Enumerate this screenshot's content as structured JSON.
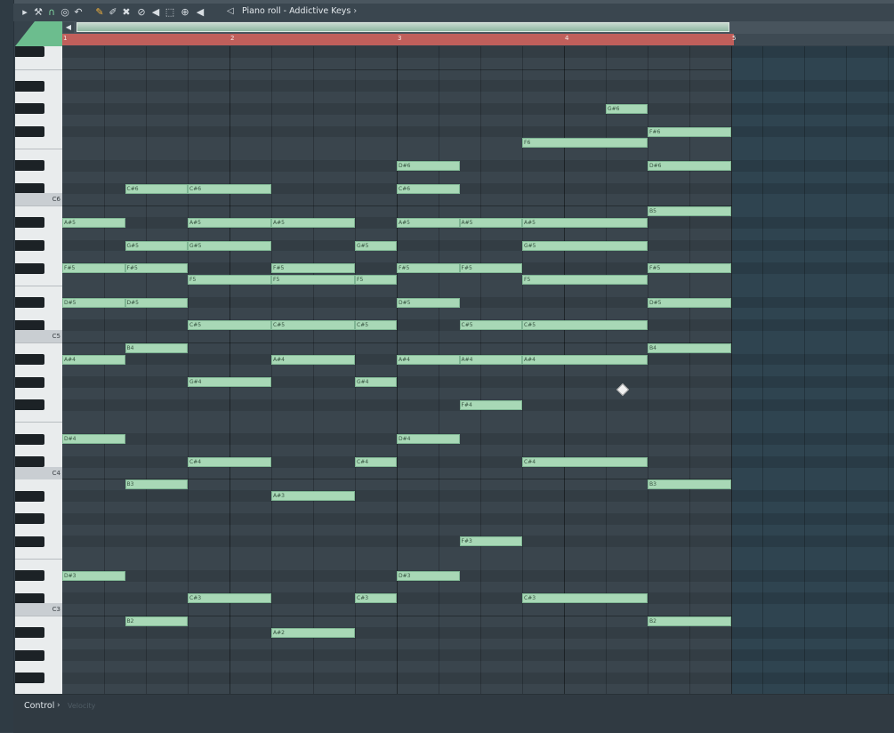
{
  "window": {
    "title": "Piano roll - Addictive Keys"
  },
  "toolbar": {
    "icons": [
      "arrow-right-icon",
      "wrench-icon",
      "magnet-icon",
      "record-icon",
      "undo-icon",
      "pencil-icon",
      "paint-brush-icon",
      "delete-icon",
      "mute-icon",
      "slip-icon",
      "select-icon",
      "zoom-icon",
      "playback-icon",
      "speaker-icon"
    ]
  },
  "timeline": {
    "bars": [
      "1",
      "2",
      "3",
      "4",
      "5"
    ]
  },
  "keyboard": {
    "c_labels": [
      "C6",
      "C5",
      "C4",
      "C3"
    ]
  },
  "control": {
    "label": "Control",
    "sub_label": "Velocity"
  },
  "notes": [
    {
      "label": "G#6"
    },
    {
      "label": "F#6"
    },
    {
      "label": "F6"
    },
    {
      "label": "D#6"
    },
    {
      "label": "D#6"
    },
    {
      "label": "C#6"
    },
    {
      "label": "C#6"
    },
    {
      "label": "C#6"
    },
    {
      "label": "B5"
    },
    {
      "label": "A#5"
    },
    {
      "label": "A#5"
    },
    {
      "label": "A#5"
    },
    {
      "label": "A#5"
    },
    {
      "label": "A#5"
    },
    {
      "label": "A#5"
    },
    {
      "label": "G#5"
    },
    {
      "label": "G#5"
    },
    {
      "label": "G#5"
    },
    {
      "label": "G#5"
    },
    {
      "label": "F#5"
    },
    {
      "label": "F#5"
    },
    {
      "label": "F#5"
    },
    {
      "label": "F#5"
    },
    {
      "label": "F#5"
    },
    {
      "label": "F#5"
    },
    {
      "label": "F5"
    },
    {
      "label": "F5"
    },
    {
      "label": "F5"
    },
    {
      "label": "F5"
    },
    {
      "label": "D#5"
    },
    {
      "label": "D#5"
    },
    {
      "label": "D#5"
    },
    {
      "label": "D#5"
    },
    {
      "label": "C#5"
    },
    {
      "label": "C#5"
    },
    {
      "label": "C#5"
    },
    {
      "label": "C#5"
    },
    {
      "label": "C#5"
    },
    {
      "label": "B4"
    },
    {
      "label": "B4"
    },
    {
      "label": "A#4"
    },
    {
      "label": "A#4"
    },
    {
      "label": "A#4"
    },
    {
      "label": "A#4"
    },
    {
      "label": "A#4"
    },
    {
      "label": "G#4"
    },
    {
      "label": "G#4"
    },
    {
      "label": "F#4"
    },
    {
      "label": "D#4"
    },
    {
      "label": "D#4"
    },
    {
      "label": "C#4"
    },
    {
      "label": "C#4"
    },
    {
      "label": "C#4"
    },
    {
      "label": "B3"
    },
    {
      "label": "B3"
    },
    {
      "label": "A#3"
    },
    {
      "label": "F#3"
    },
    {
      "label": "D#3"
    },
    {
      "label": "D#3"
    },
    {
      "label": "C#3"
    },
    {
      "label": "C#3"
    },
    {
      "label": "C#3"
    },
    {
      "label": "B2"
    },
    {
      "label": "B2"
    },
    {
      "label": "A#2"
    }
  ],
  "colors": {
    "note": "#a8d8b6",
    "ruler": "#c05f5b",
    "accent": "#6cbd8e"
  }
}
